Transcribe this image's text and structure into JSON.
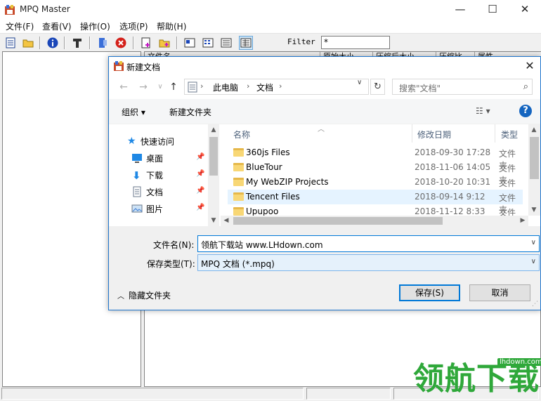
{
  "app": {
    "title": "MPQ Master",
    "menus": [
      "文件(F)",
      "查看(V)",
      "操作(O)",
      "选项(P)",
      "帮助(H)"
    ],
    "toolbar_icons": [
      "new-icon",
      "open-icon",
      "info-icon",
      "build-icon",
      "extract-icon",
      "delete-icon",
      "add-file-icon",
      "add-folder-icon",
      "view-large-icon",
      "view-small-icon",
      "view-list-icon",
      "view-details-icon"
    ],
    "filter_label": "Filter",
    "filter_value": "*",
    "list_columns": [
      "文件名",
      "原始大小",
      "压缩后大小",
      "压缩比",
      "属性"
    ]
  },
  "dialog": {
    "title": "新建文档",
    "breadcrumb": [
      "此电脑",
      "文档"
    ],
    "search_placeholder": "搜索\"文档\"",
    "organize_label": "组织 ▾",
    "new_folder_label": "新建文件夹",
    "nav_items": [
      {
        "label": "快速访问",
        "icon": "star-icon"
      },
      {
        "label": "桌面",
        "icon": "desktop-icon"
      },
      {
        "label": "下载",
        "icon": "download-icon"
      },
      {
        "label": "文档",
        "icon": "document-icon"
      },
      {
        "label": "图片",
        "icon": "pictures-icon"
      }
    ],
    "columns": {
      "name": "名称",
      "date": "修改日期",
      "type": "类型"
    },
    "files": [
      {
        "name": "360js Files",
        "date": "2018-09-30 17:28",
        "type": "文件夹"
      },
      {
        "name": "BlueTour",
        "date": "2018-11-06 14:05",
        "type": "文件夹"
      },
      {
        "name": "My WebZIP Projects",
        "date": "2018-10-20 10:31",
        "type": "文件夹"
      },
      {
        "name": "Tencent Files",
        "date": "2018-09-14 9:12",
        "type": "文件夹"
      },
      {
        "name": "Upupoo",
        "date": "2018-11-12 8:33",
        "type": "文件夹"
      }
    ],
    "filename_label": "文件名(N):",
    "filename_value": "领航下载站   www.LHdown.com",
    "filetype_label": "保存类型(T):",
    "filetype_value": "MPQ 文档 (*.mpq)",
    "hide_folders_label": "隐藏文件夹",
    "save_label": "保存(S)",
    "cancel_label": "取消"
  },
  "watermark": {
    "text": "领航下载",
    "url": "lhdown.com"
  },
  "colors": {
    "accent": "#0078d7",
    "selection": "#e5f3ff",
    "folder": "#f8d775",
    "watermark": "#2fa83a"
  }
}
